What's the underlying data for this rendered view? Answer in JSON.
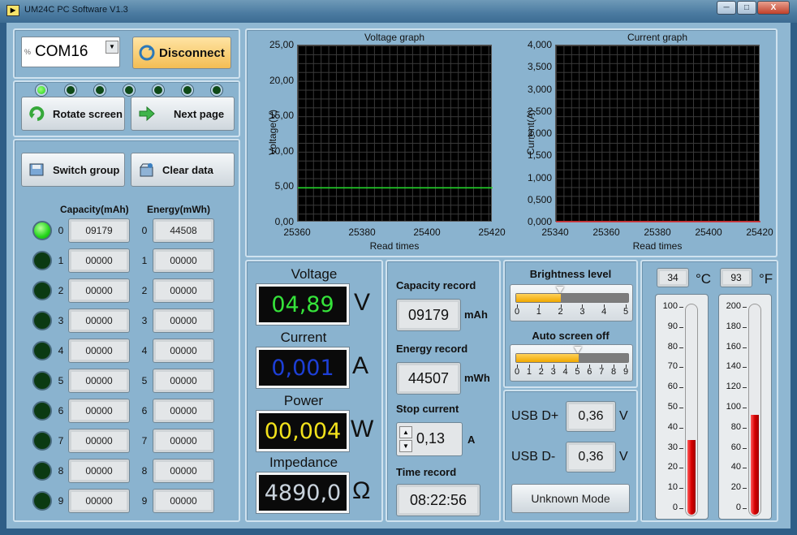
{
  "window": {
    "title": "UM24C PC Software V1.3",
    "minimize": "─",
    "maximize": "□",
    "close": "X"
  },
  "connection": {
    "port_prefix": "%",
    "port": "COM16",
    "disconnect_label": "Disconnect"
  },
  "indicators": [
    true,
    false,
    false,
    false,
    false,
    false,
    false
  ],
  "nav": {
    "rotate_label": "Rotate screen",
    "next_label": "Next page"
  },
  "data_group": {
    "switch_label": "Switch group",
    "clear_label": "Clear data",
    "capacity_header": "Capacity(mAh)",
    "energy_header": "Energy(mWh)",
    "rows": [
      {
        "idx": "0",
        "capacity": "09179",
        "energy": "44508",
        "active": true
      },
      {
        "idx": "1",
        "capacity": "00000",
        "energy": "00000",
        "active": false
      },
      {
        "idx": "2",
        "capacity": "00000",
        "energy": "00000",
        "active": false
      },
      {
        "idx": "3",
        "capacity": "00000",
        "energy": "00000",
        "active": false
      },
      {
        "idx": "4",
        "capacity": "00000",
        "energy": "00000",
        "active": false
      },
      {
        "idx": "5",
        "capacity": "00000",
        "energy": "00000",
        "active": false
      },
      {
        "idx": "6",
        "capacity": "00000",
        "energy": "00000",
        "active": false
      },
      {
        "idx": "7",
        "capacity": "00000",
        "energy": "00000",
        "active": false
      },
      {
        "idx": "8",
        "capacity": "00000",
        "energy": "00000",
        "active": false
      },
      {
        "idx": "9",
        "capacity": "00000",
        "energy": "00000",
        "active": false
      }
    ]
  },
  "chart_data": [
    {
      "type": "line",
      "title": "Voltage graph",
      "xlabel": "Read times",
      "ylabel": "Voltage(V)",
      "x_ticks": [
        "25360",
        "25380",
        "25400",
        "25420"
      ],
      "y_ticks": [
        "25,00",
        "20,00",
        "15,00",
        "10,00",
        "5,00",
        "0,00"
      ],
      "xlim": [
        25360,
        25420
      ],
      "ylim": [
        0,
        25
      ],
      "series": [
        {
          "color": "#22e02a",
          "x": [
            25360,
            25420
          ],
          "y": [
            4.89,
            4.89
          ]
        }
      ],
      "grid": true
    },
    {
      "type": "line",
      "title": "Current graph",
      "xlabel": "Read times",
      "ylabel": "Current(A)",
      "x_ticks": [
        "25340",
        "25360",
        "25380",
        "25400",
        "25420"
      ],
      "y_ticks": [
        "4,000",
        "3,500",
        "3,000",
        "2,500",
        "2,000",
        "1,500",
        "1,000",
        "0,500",
        "0,000"
      ],
      "xlim": [
        25340,
        25420
      ],
      "ylim": [
        0,
        4
      ],
      "series": [
        {
          "color": "#e02020",
          "x": [
            25340,
            25420
          ],
          "y": [
            0.001,
            0.001
          ]
        }
      ],
      "grid": true
    }
  ],
  "readings": {
    "voltage_label": "Voltage",
    "voltage": "04,89",
    "voltage_unit": "V",
    "voltage_color": "#35e33a",
    "current_label": "Current",
    "current": "0,001",
    "current_unit": "A",
    "current_color": "#1d3fd6",
    "power_label": "Power",
    "power": "00,004",
    "power_unit": "W",
    "power_color": "#f2e21c",
    "impedance_label": "Impedance",
    "impedance": "4890,0",
    "impedance_unit": "Ω",
    "impedance_color": "#c9d3dc"
  },
  "records": {
    "capacity_label": "Capacity record",
    "capacity": "09179",
    "capacity_unit": "mAh",
    "energy_label": "Energy record",
    "energy": "44507",
    "energy_unit": "mWh",
    "stop_label": "Stop current",
    "stop": "0,13",
    "stop_unit": "A",
    "time_label": "Time record",
    "time": "08:22:56"
  },
  "brightness": {
    "label": "Brightness level",
    "ticks": [
      "0",
      "1",
      "2",
      "3",
      "4",
      "5"
    ],
    "value": 2
  },
  "auto_off": {
    "label": "Auto screen off",
    "ticks": [
      "0",
      "1",
      "2",
      "3",
      "4",
      "5",
      "6",
      "7",
      "8",
      "9"
    ],
    "value": 5
  },
  "usb": {
    "dplus_label": "USB D+",
    "dplus": "0,36",
    "dminus_label": "USB D-",
    "dminus": "0,36",
    "unit": "V",
    "mode": "Unknown Mode"
  },
  "temperature": {
    "c_value": "34",
    "c_unit": "°C",
    "f_value": "93",
    "f_unit": "°F",
    "c_scale": [
      "100",
      "90",
      "80",
      "70",
      "60",
      "50",
      "40",
      "30",
      "20",
      "10",
      "0"
    ],
    "f_scale": [
      "200",
      "180",
      "160",
      "140",
      "120",
      "100",
      "80",
      "60",
      "40",
      "20",
      "0"
    ],
    "c_fraction": 0.34,
    "f_fraction": 0.465
  }
}
